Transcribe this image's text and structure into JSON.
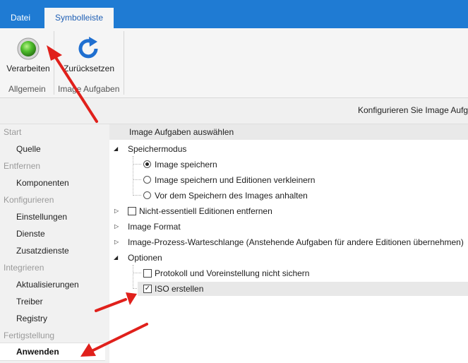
{
  "ribbon": {
    "tabs": [
      {
        "label": "Datei"
      },
      {
        "label": "Symbolleiste"
      }
    ],
    "buttons": {
      "verarbeiten": "Verarbeiten",
      "zuruecksetzen": "Zurücksetzen"
    },
    "groups": {
      "allgemein": "Allgemein",
      "image_aufgaben": "Image Aufgaben"
    }
  },
  "header": {
    "text": "Konfigurieren Sie Image Aufga"
  },
  "sidebar": {
    "sections": [
      {
        "label": "Start",
        "items": [
          "Quelle"
        ]
      },
      {
        "label": "Entfernen",
        "items": [
          "Komponenten"
        ]
      },
      {
        "label": "Konfigurieren",
        "items": [
          "Einstellungen",
          "Dienste",
          "Zusatzdienste"
        ]
      },
      {
        "label": "Integrieren",
        "items": [
          "Aktualisierungen",
          "Treiber",
          "Registry"
        ]
      },
      {
        "label": "Fertigstellung",
        "items": [
          "Anwenden"
        ]
      }
    ]
  },
  "main": {
    "title": "Image Aufgaben auswählen",
    "speichermodus": {
      "label": "Speichermodus",
      "options": [
        {
          "label": "Image speichern",
          "selected": true
        },
        {
          "label": "Image speichern und Editionen verkleinern",
          "selected": false
        },
        {
          "label": "Vor dem Speichern des Images anhalten",
          "selected": false
        }
      ]
    },
    "nicht_essentiell": {
      "label": "Nicht-essentiell Editionen entfernen",
      "checked": false
    },
    "image_format": "Image Format",
    "warteschlange": "Image-Prozess-Warteschlange (Anstehende Aufgaben für andere Editionen übernehmen)",
    "optionen": {
      "label": "Optionen",
      "items": [
        {
          "label": "Protokoll und Voreinstellung nicht sichern",
          "checked": false
        },
        {
          "label": "ISO erstellen",
          "checked": true
        }
      ]
    }
  },
  "colors": {
    "accent": "#1f7bd3",
    "arrow": "#e0201b"
  }
}
